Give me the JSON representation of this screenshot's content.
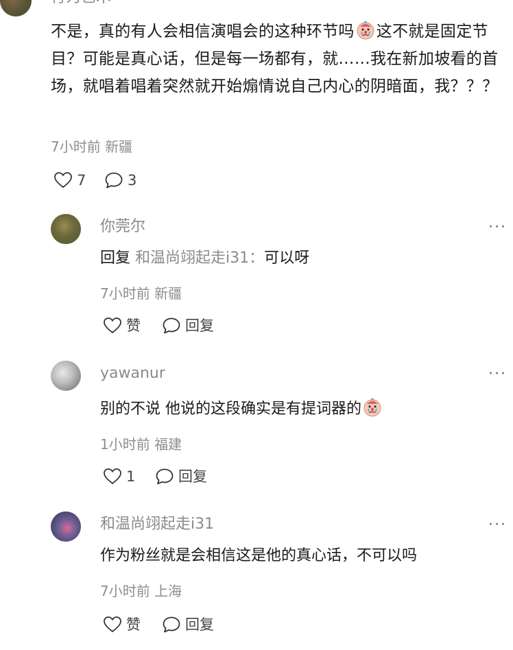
{
  "main_comment": {
    "author_partial": "行为艺术",
    "text_before_emoji1": "不是，真的有人会相信演唱会的这种环节吗",
    "text_after_emoji1": "这不就是固定节目？可能是真心话，但是每一场都有，就……我在新加坡看的首场，就唱着唱着突然就开始煽情说自己内心的阴暗面，我？？？",
    "meta": "7小时前 新疆",
    "like_count": "7",
    "reply_count": "3"
  },
  "replies": [
    {
      "username": "你莞尔",
      "reply_prefix": "回复",
      "reply_target": "和温尚翊起走i31：",
      "text": "可以呀",
      "meta": "7小时前 新疆",
      "like_label": "赞",
      "reply_label": "回复"
    },
    {
      "username": "yawanur",
      "text": "别的不说 他说的这段确实是有提词器的",
      "meta": "1小时前 福建",
      "like_label": "1",
      "reply_label": "回复"
    },
    {
      "username": "和温尚翊起走i31",
      "text": "作为粉丝就是会相信这是他的真心话，不可以吗",
      "meta": "7小时前 上海",
      "like_label": "赞",
      "reply_label": "回复"
    }
  ],
  "more_label": "···",
  "icons": {
    "like": "heart-outline-icon",
    "reply": "speech-bubble-icon",
    "emoji": "crying-clown-emoji"
  }
}
